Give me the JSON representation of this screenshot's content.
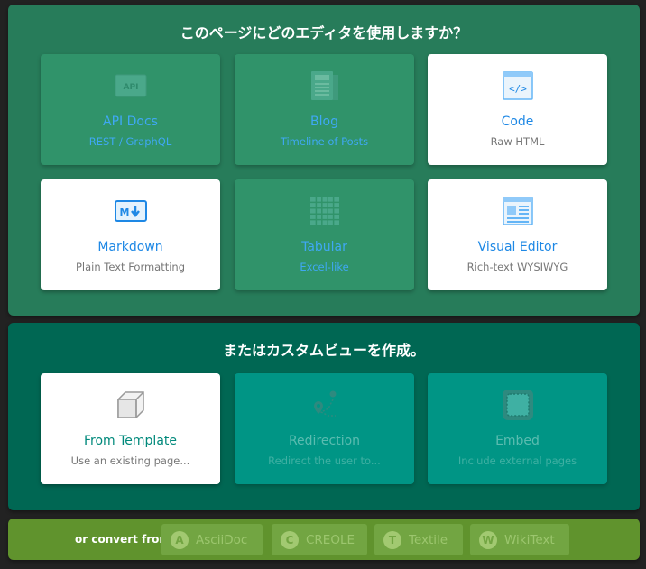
{
  "editors_panel": {
    "title": "このページにどのエディタを使用しますか？",
    "cards": [
      {
        "title": "API Docs",
        "subtitle": "REST / GraphQL",
        "icon": "api-icon"
      },
      {
        "title": "Blog",
        "subtitle": "Timeline of Posts",
        "icon": "blog-icon"
      },
      {
        "title": "Code",
        "subtitle": "Raw HTML",
        "icon": "code-icon"
      },
      {
        "title": "Markdown",
        "subtitle": "Plain Text Formatting",
        "icon": "markdown-icon"
      },
      {
        "title": "Tabular",
        "subtitle": "Excel-like",
        "icon": "table-icon"
      },
      {
        "title": "Visual Editor",
        "subtitle": "Rich-text WYSIWYG",
        "icon": "visual-editor-icon"
      }
    ]
  },
  "custom_panel": {
    "title": "またはカスタムビューを作成。",
    "cards": [
      {
        "title": "From Template",
        "subtitle": "Use an existing page...",
        "icon": "cube-icon"
      },
      {
        "title": "Redirection",
        "subtitle": "Redirect the user to...",
        "icon": "route-icon"
      },
      {
        "title": "Embed",
        "subtitle": "Include external pages",
        "icon": "embed-icon"
      }
    ]
  },
  "convert_panel": {
    "label": "or convert from",
    "formats": [
      {
        "letter": "A",
        "name": "AsciiDoc"
      },
      {
        "letter": "C",
        "name": "CREOLE"
      },
      {
        "letter": "T",
        "name": "Textile"
      },
      {
        "letter": "W",
        "name": "WikiText"
      }
    ]
  },
  "colors": {
    "editors_panel_bg": "#277c5a",
    "custom_panel_bg": "#006753",
    "convert_panel_bg": "#60932d",
    "accent_blue": "#1e88e5",
    "accent_teal": "#00897b"
  }
}
